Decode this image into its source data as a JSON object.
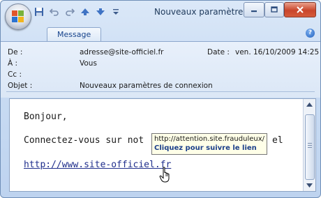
{
  "window": {
    "title": "Nouveaux paramètres..."
  },
  "ribbon": {
    "tab_message": "Message"
  },
  "headers": {
    "from_label": "De :",
    "from_value": "adresse@site-officiel.fr",
    "to_label": "À :",
    "to_value": "Vous",
    "cc_label": "Cc :",
    "cc_value": "",
    "subject_label": "Objet :",
    "subject_value": "Nouveaux paramètres de connexion",
    "date_label": "Date :",
    "date_value": "ven. 16/10/2009 14:25"
  },
  "body": {
    "greeting": "Bonjour,",
    "line_prefix": "Connectez-vous sur not",
    "line_suffix": "el",
    "link_text": "http://www.site-officiel.fr"
  },
  "tooltip": {
    "url": "http://attention.site.frauduleux/",
    "hint": "Cliquez pour suivre le lien"
  },
  "icons": {
    "office_button": "office-logo-icon",
    "save": "save-icon",
    "undo": "undo-icon",
    "redo": "redo-icon",
    "up": "previous-item-icon",
    "down": "next-item-icon",
    "customize": "customize-qat-icon",
    "help": "help-icon",
    "cursor": "hand-pointer-icon"
  },
  "colors": {
    "window_frame": "#c9dcf3",
    "link": "#1f2e8c",
    "tooltip_bg": "#ffffe8",
    "close_button": "#c9452b"
  }
}
